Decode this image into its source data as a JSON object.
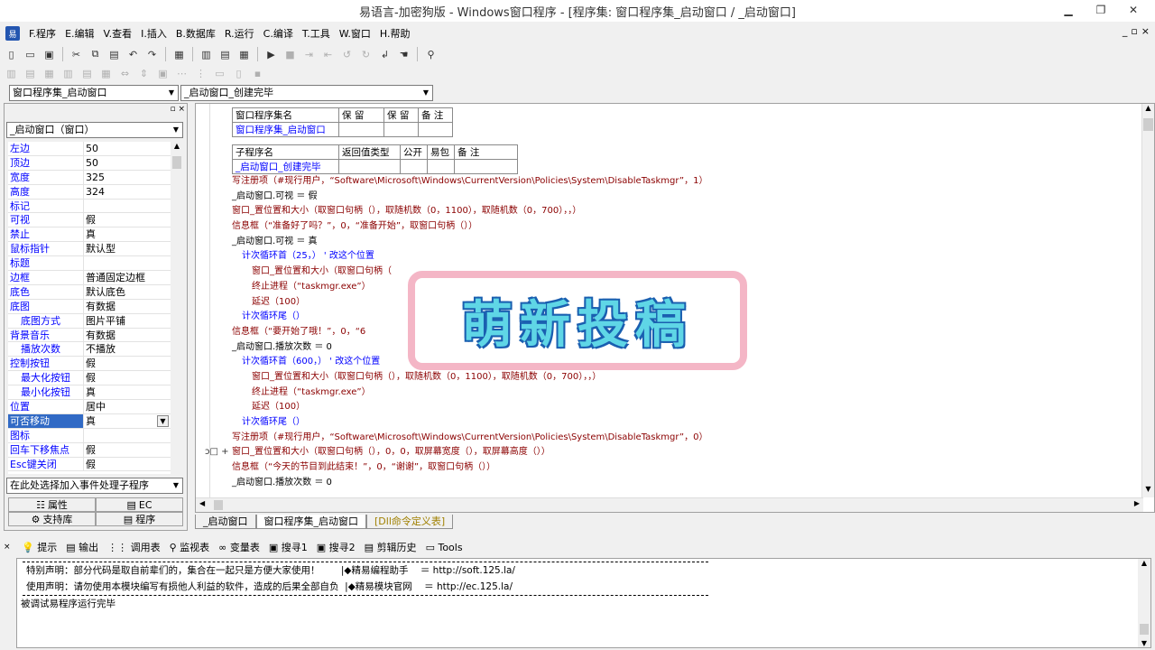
{
  "window": {
    "title": "易语言-加密狗版 - Windows窗口程序 - [程序集: 窗口程序集_启动窗口 / _启动窗口]"
  },
  "menu": [
    "F.程序",
    "E.编辑",
    "V.查看",
    "I.插入",
    "B.数据库",
    "R.运行",
    "C.编译",
    "T.工具",
    "W.窗口",
    "H.帮助"
  ],
  "combos": {
    "left": "窗口程序集_启动窗口",
    "right": "_启动窗口_创建完毕",
    "object": "_启动窗口（窗口）",
    "event": "在此处选择加入事件处理子程序"
  },
  "props": [
    {
      "name": "左边",
      "value": "50"
    },
    {
      "name": "顶边",
      "value": "50"
    },
    {
      "name": "宽度",
      "value": "325"
    },
    {
      "name": "高度",
      "value": "324"
    },
    {
      "name": "标记",
      "value": ""
    },
    {
      "name": "可视",
      "value": "假"
    },
    {
      "name": "禁止",
      "value": "真"
    },
    {
      "name": "鼠标指针",
      "value": "默认型"
    },
    {
      "name": "标题",
      "value": ""
    },
    {
      "name": "边框",
      "value": "普通固定边框"
    },
    {
      "name": "底色",
      "value": "默认底色"
    },
    {
      "name": "底图",
      "value": "有数据"
    },
    {
      "name": "底图方式",
      "value": "图片平铺",
      "sub": true
    },
    {
      "name": "背景音乐",
      "value": "有数据"
    },
    {
      "name": "播放次数",
      "value": "不播放",
      "sub": true
    },
    {
      "name": "控制按钮",
      "value": "假"
    },
    {
      "name": "最大化按钮",
      "value": "假",
      "sub": true
    },
    {
      "name": "最小化按钮",
      "value": "真",
      "sub": true
    },
    {
      "name": "位置",
      "value": "居中"
    },
    {
      "name": "可否移动",
      "value": "真",
      "sel": true
    },
    {
      "name": "图标",
      "value": ""
    },
    {
      "name": "回车下移焦点",
      "value": "假"
    },
    {
      "name": "Esc键关闭",
      "value": "假"
    }
  ],
  "left_tabs": [
    {
      "label": "属性",
      "icon": "property-icon"
    },
    {
      "label": "EC",
      "icon": "ec-icon"
    },
    {
      "label": "支持库",
      "icon": "library-icon"
    },
    {
      "label": "程序",
      "icon": "program-icon"
    }
  ],
  "assembly_table": {
    "headers": [
      "窗口程序集名",
      "保 留",
      "保 留",
      "备 注"
    ],
    "row": "窗口程序集_启动窗口"
  },
  "sub_table": {
    "headers": [
      "子程序名",
      "返回值类型",
      "公开",
      "易包",
      "备 注"
    ],
    "row": "_启动窗口_创建完毕"
  },
  "code": [
    {
      "t": "写注册项（#现行用户，“Software\\Microsoft\\Windows\\CurrentVersion\\Policies\\System\\DisableTaskmgr”，1）",
      "c": "red",
      "i": 0
    },
    {
      "t": "_启动窗口.可视 ＝ 假",
      "c": "blk",
      "i": 0
    },
    {
      "t": "窗口_置位置和大小（取窗口句柄（），取随机数（0，1100），取随机数（0，700），，）",
      "c": "red",
      "i": 0
    },
    {
      "t": "信息框（“准备好了吗？”，0，“准备开始”，取窗口句柄（））",
      "c": "red",
      "i": 0
    },
    {
      "t": "_启动窗口.可视 ＝ 真",
      "c": "blk",
      "i": 0
    },
    {
      "t": "计次循环首（25，） ' 改这个位置",
      "c": "red",
      "i": 1,
      "loop": "start"
    },
    {
      "t": "窗口_置位置和大小（取窗口句柄（",
      "c": "red",
      "i": 2
    },
    {
      "t": "终止进程（“taskmgr.exe”）",
      "c": "red",
      "i": 2
    },
    {
      "t": "延迟（100）",
      "c": "red",
      "i": 2
    },
    {
      "t": "计次循环尾（）",
      "c": "red",
      "i": 1,
      "loop": "end"
    },
    {
      "t": "信息框（“要开始了哦！”，0，“6",
      "c": "red",
      "i": 0
    },
    {
      "t": "_启动窗口.播放次数 ＝ 0",
      "c": "blk",
      "i": 0
    },
    {
      "t": "计次循环首（600，） ' 改这个位置",
      "c": "red",
      "i": 1,
      "loop": "start"
    },
    {
      "t": "窗口_置位置和大小（取窗口句柄（），取随机数（0，1100），取随机数（0，700），，）",
      "c": "red",
      "i": 2
    },
    {
      "t": "终止进程（“taskmgr.exe”）",
      "c": "red",
      "i": 2
    },
    {
      "t": "延迟（100）",
      "c": "red",
      "i": 2
    },
    {
      "t": "计次循环尾（）",
      "c": "red",
      "i": 1,
      "loop": "end"
    },
    {
      "t": "写注册项（#现行用户，“Software\\Microsoft\\Windows\\CurrentVersion\\Policies\\System\\DisableTaskmgr”，0）",
      "c": "red",
      "i": 0
    },
    {
      "t": "窗口_置位置和大小（取窗口句柄（），0，0，取屏幕宽度（），取屏幕高度（））",
      "c": "red",
      "i": 0,
      "marker": "ↄ□ +"
    },
    {
      "t": "信息框（“今天的节目到此结束！”，0，“谢谢”，取窗口句柄（））",
      "c": "red",
      "i": 0
    },
    {
      "t": "_启动窗口.播放次数 ＝ 0",
      "c": "blk",
      "i": 0
    }
  ],
  "editor_tabs": [
    "_启动窗口",
    "窗口程序集_启动窗口",
    "[Dll命令定义表]"
  ],
  "output_tabs": [
    {
      "label": "提示",
      "icon": "hint-icon"
    },
    {
      "label": "输出",
      "icon": "output-icon"
    },
    {
      "label": "调用表",
      "icon": "calltable-icon"
    },
    {
      "label": "监视表",
      "icon": "watch-icon"
    },
    {
      "label": "变量表",
      "icon": "vartable-icon"
    },
    {
      "label": "搜寻1",
      "icon": "search1-icon"
    },
    {
      "label": "搜寻2",
      "icon": "search2-icon"
    },
    {
      "label": "剪辑历史",
      "icon": "clip-icon"
    },
    {
      "label": "Tools",
      "icon": "tools-icon"
    }
  ],
  "output": [
    "特别声明：部分代码是取自前辈们的，集合在一起只是方便大家使用！       |◆精易编程助手    ＝ http://soft.125.la/",
    "使用声明：请勿使用本模块编写有损他人利益的软件，造成的后果全部自负  |◆精易模块官网    ＝ http://ec.125.la/",
    "被调试易程序运行完毕"
  ],
  "watermark": "萌新投稿"
}
